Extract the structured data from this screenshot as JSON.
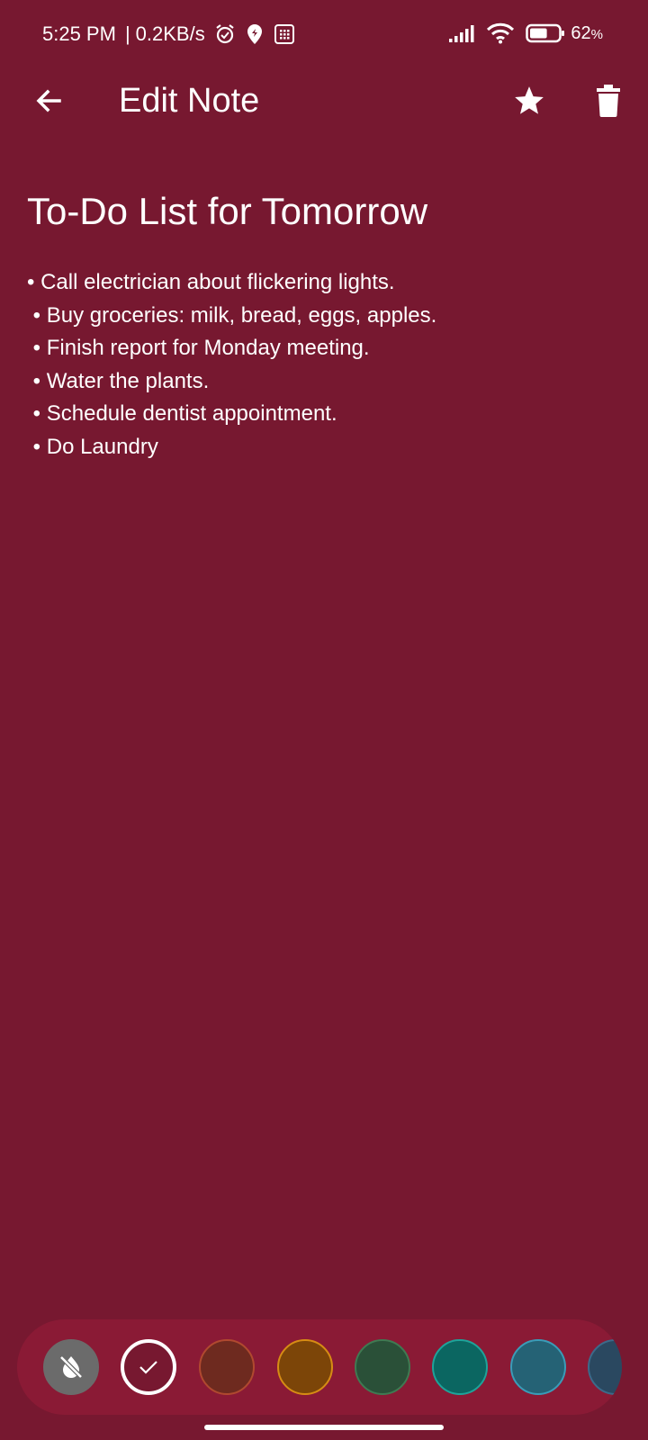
{
  "status_bar": {
    "time": "5:25 PM",
    "separator": "|",
    "net_speed": "0.2KB/s",
    "icons": [
      "alarm-icon",
      "location-icon",
      "sim-card-icon"
    ],
    "right_icons": [
      "signal-icon",
      "wifi-icon",
      "battery-icon"
    ],
    "battery_percent": "62",
    "battery_unit": "%",
    "battery_level": 0.62
  },
  "app_bar": {
    "title": "Edit Note",
    "icons": [
      "back-arrow-icon",
      "star-icon",
      "trash-icon"
    ]
  },
  "note": {
    "title": "To-Do List for Tomorrow",
    "body": "• Call electrician about flickering lights.\n • Buy groceries: milk, bread, eggs, apples.\n • Finish report for Monday meeting.\n • Water the plants.\n • Schedule dentist appointment.\n • Do Laundry"
  },
  "color_picker": {
    "selected_index": 1,
    "swatches": [
      {
        "name": "no-color",
        "fill": "#6b6b6b",
        "border": "#6b6b6b",
        "icon": "no-color-drop-icon"
      },
      {
        "name": "default",
        "fill": "#771830",
        "border": "#ffffff",
        "icon": "check-icon"
      },
      {
        "name": "brick-red",
        "fill": "#6e2a1f",
        "border": "#b0492f"
      },
      {
        "name": "amber",
        "fill": "#7c4508",
        "border": "#d68c14"
      },
      {
        "name": "forest-green",
        "fill": "#2a5038",
        "border": "#3f7a52"
      },
      {
        "name": "teal",
        "fill": "#0b6661",
        "border": "#1ea39a"
      },
      {
        "name": "steel-blue",
        "fill": "#256275",
        "border": "#3a9cb8"
      },
      {
        "name": "navy",
        "fill": "#2a4860",
        "border": "#3c6a8a"
      }
    ]
  },
  "colors": {
    "background": "#771830",
    "picker_background": "#8a1a35",
    "foreground": "#ffffff"
  }
}
